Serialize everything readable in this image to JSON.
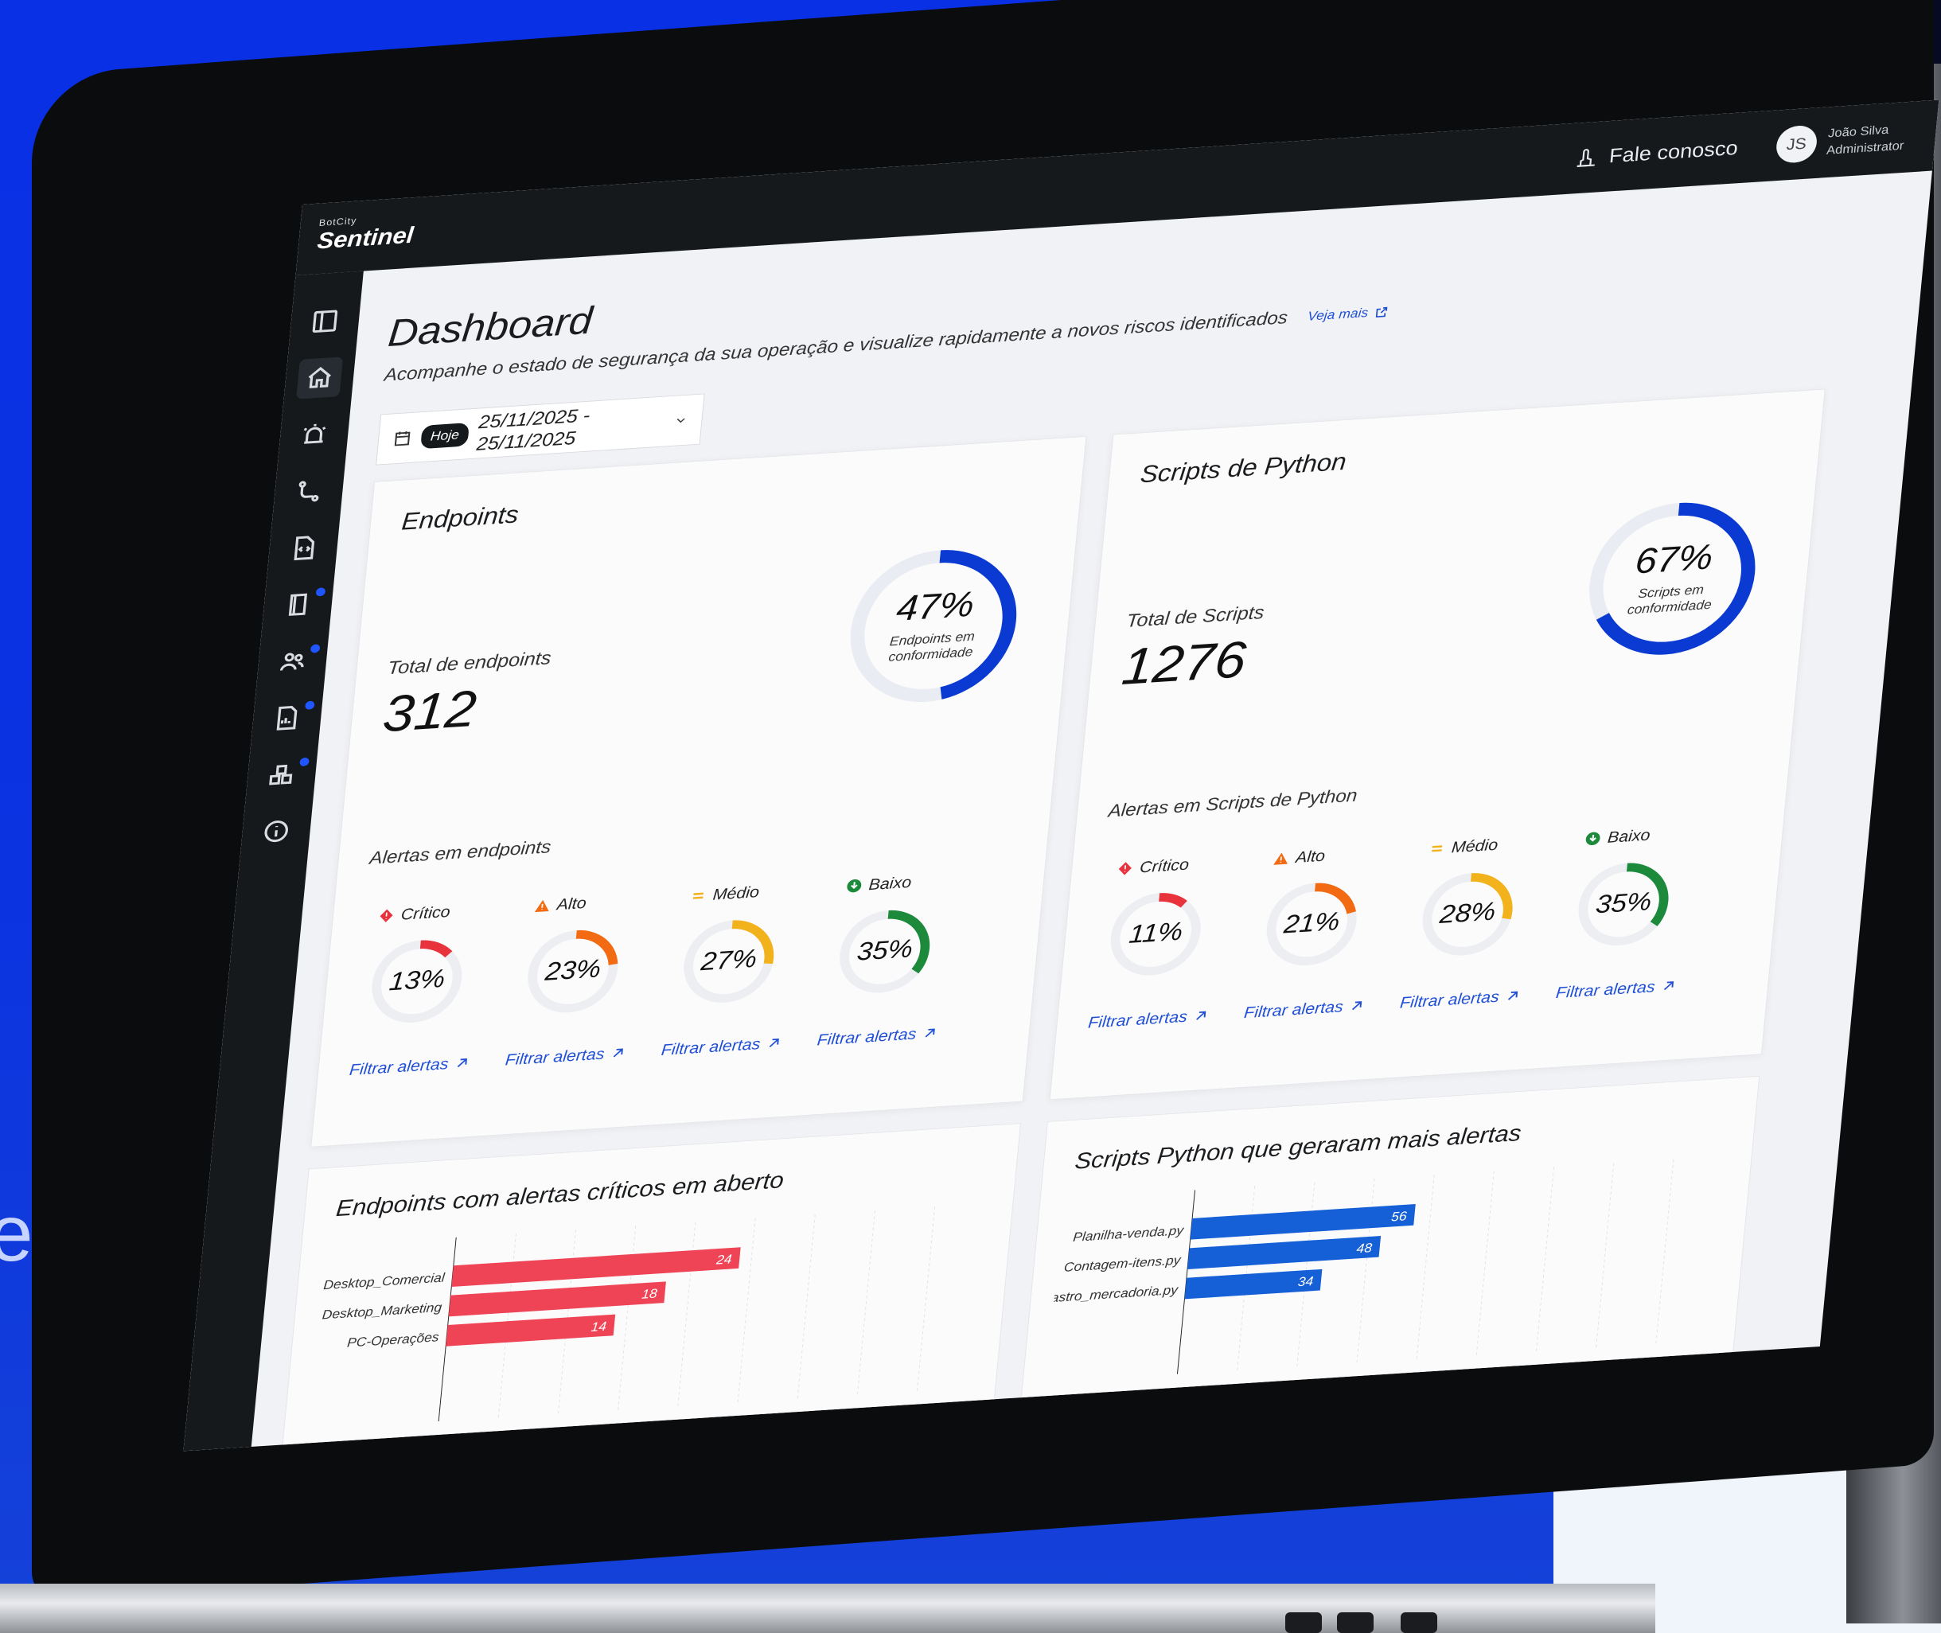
{
  "brand": {
    "small": "BotCity",
    "name": "Sentinel"
  },
  "topbar": {
    "contact_label": "Fale conosco",
    "user_initials": "JS",
    "user_name": "João Silva",
    "user_role": "Administrator"
  },
  "background_letter": "e",
  "page": {
    "title": "Dashboard",
    "subtitle": "Acompanhe o estado de segurança da sua operação e visualize rapidamente a novos riscos identificados",
    "more_link": "Veja mais"
  },
  "date_filter": {
    "badge": "Hoje",
    "range": "25/11/2025 - 25/11/2025"
  },
  "endpoints_card": {
    "title": "Endpoints",
    "total_label": "Total de endpoints",
    "total_value": "312",
    "compliance_pct": "47%",
    "compliance_value": 47,
    "compliance_label": "Endpoints em conformidade",
    "alerts_title": "Alertas em endpoints",
    "severities": [
      {
        "label": "Crítico",
        "pct": "13%",
        "value": 13,
        "color": "#e8323c",
        "filter": "Filtrar alertas"
      },
      {
        "label": "Alto",
        "pct": "23%",
        "value": 23,
        "color": "#f26b13",
        "filter": "Filtrar alertas"
      },
      {
        "label": "Médio",
        "pct": "27%",
        "value": 27,
        "color": "#f2b21c",
        "filter": "Filtrar alertas"
      },
      {
        "label": "Baixo",
        "pct": "35%",
        "value": 35,
        "color": "#1c8a3a",
        "filter": "Filtrar alertas"
      }
    ]
  },
  "scripts_card": {
    "title": "Scripts de Python",
    "total_label": "Total de Scripts",
    "total_value": "1276",
    "compliance_pct": "67%",
    "compliance_value": 67,
    "compliance_label": "Scripts em conformidade",
    "alerts_title": "Alertas em Scripts de Python",
    "severities": [
      {
        "label": "Crítico",
        "pct": "11%",
        "value": 11,
        "color": "#e8323c",
        "filter": "Filtrar alertas"
      },
      {
        "label": "Alto",
        "pct": "21%",
        "value": 21,
        "color": "#f26b13",
        "filter": "Filtrar alertas"
      },
      {
        "label": "Médio",
        "pct": "28%",
        "value": 28,
        "color": "#f2b21c",
        "filter": "Filtrar alertas"
      },
      {
        "label": "Baixo",
        "pct": "35%",
        "value": 35,
        "color": "#1c8a3a",
        "filter": "Filtrar alertas"
      }
    ]
  },
  "colors": {
    "accent": "#1f4fd6",
    "donut": "#0a3ad1",
    "critical_bar": "#ef4456",
    "script_bar": "#1560d6"
  },
  "chart_data": [
    {
      "type": "bar",
      "title": "Endpoints com alertas críticos em aberto",
      "orientation": "horizontal",
      "categories": [
        "Desktop_Comercial",
        "Desktop_Marketing",
        "PC-Operações"
      ],
      "values": [
        24,
        18,
        14
      ],
      "xlim": [
        0,
        40
      ]
    },
    {
      "type": "bar",
      "title": "Scripts Python que geraram mais alertas",
      "orientation": "horizontal",
      "categories": [
        "Planilha-venda.py",
        "Contagem-itens.py",
        "Cadastro_mercadoria.py"
      ],
      "values": [
        56,
        48,
        34
      ],
      "xlim": [
        0,
        120
      ]
    }
  ]
}
